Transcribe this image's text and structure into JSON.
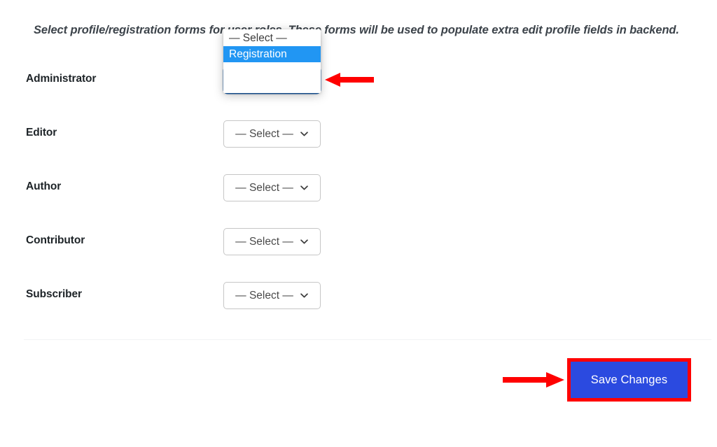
{
  "intro": {
    "text": "Select profile/registration forms for user roles. These forms will be used to populate extra edit profile fields in backend."
  },
  "placeholder_option": "— Select —",
  "rows": [
    {
      "label": "Administrator",
      "value": "Registration",
      "state": "open",
      "caret_icon": "chevron-down-icon"
    },
    {
      "label": "Editor",
      "value": "— Select —",
      "state": "closed",
      "caret_icon": "chevron-down-icon"
    },
    {
      "label": "Author",
      "value": "— Select —",
      "state": "closed",
      "caret_icon": "chevron-down-icon"
    },
    {
      "label": "Contributor",
      "value": "— Select —",
      "state": "closed",
      "caret_icon": "chevron-down-icon"
    },
    {
      "label": "Subscriber",
      "value": "— Select —",
      "state": "closed",
      "caret_icon": "chevron-down-icon"
    }
  ],
  "dropdown": {
    "options": [
      {
        "label": "— Select —",
        "selected": false
      },
      {
        "label": "Registration",
        "selected": true
      }
    ]
  },
  "save": {
    "label": "Save Changes"
  },
  "annotations": [
    {
      "name": "arrow-to-administrator-select",
      "direction": "left",
      "color": "#ff0000"
    },
    {
      "name": "arrow-to-save-button",
      "direction": "right",
      "color": "#ff0000"
    }
  ],
  "colors": {
    "accent_blue": "#2b4ae0",
    "highlight_blue": "#2196f3",
    "focus_border": "#1c64b5",
    "annotation_red": "#ff0000",
    "label_text": "#1d2327",
    "intro_text": "#3c434a",
    "select_border": "#c6c6c6",
    "divider": "#f2f3f4",
    "background": "#ffffff"
  }
}
